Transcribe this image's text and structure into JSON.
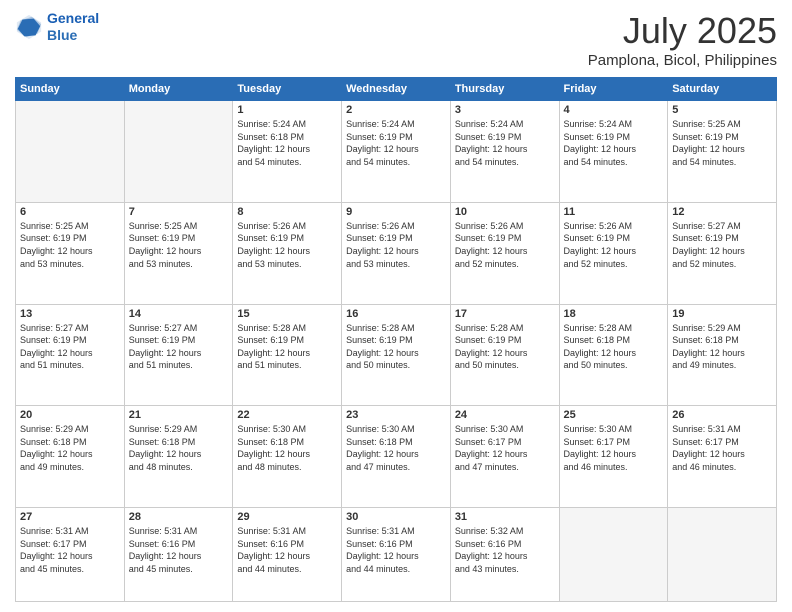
{
  "header": {
    "logo_line1": "General",
    "logo_line2": "Blue",
    "month": "July 2025",
    "location": "Pamplona, Bicol, Philippines"
  },
  "weekdays": [
    "Sunday",
    "Monday",
    "Tuesday",
    "Wednesday",
    "Thursday",
    "Friday",
    "Saturday"
  ],
  "weeks": [
    [
      {
        "day": "",
        "info": ""
      },
      {
        "day": "",
        "info": ""
      },
      {
        "day": "1",
        "info": "Sunrise: 5:24 AM\nSunset: 6:18 PM\nDaylight: 12 hours\nand 54 minutes."
      },
      {
        "day": "2",
        "info": "Sunrise: 5:24 AM\nSunset: 6:19 PM\nDaylight: 12 hours\nand 54 minutes."
      },
      {
        "day": "3",
        "info": "Sunrise: 5:24 AM\nSunset: 6:19 PM\nDaylight: 12 hours\nand 54 minutes."
      },
      {
        "day": "4",
        "info": "Sunrise: 5:24 AM\nSunset: 6:19 PM\nDaylight: 12 hours\nand 54 minutes."
      },
      {
        "day": "5",
        "info": "Sunrise: 5:25 AM\nSunset: 6:19 PM\nDaylight: 12 hours\nand 54 minutes."
      }
    ],
    [
      {
        "day": "6",
        "info": "Sunrise: 5:25 AM\nSunset: 6:19 PM\nDaylight: 12 hours\nand 53 minutes."
      },
      {
        "day": "7",
        "info": "Sunrise: 5:25 AM\nSunset: 6:19 PM\nDaylight: 12 hours\nand 53 minutes."
      },
      {
        "day": "8",
        "info": "Sunrise: 5:26 AM\nSunset: 6:19 PM\nDaylight: 12 hours\nand 53 minutes."
      },
      {
        "day": "9",
        "info": "Sunrise: 5:26 AM\nSunset: 6:19 PM\nDaylight: 12 hours\nand 53 minutes."
      },
      {
        "day": "10",
        "info": "Sunrise: 5:26 AM\nSunset: 6:19 PM\nDaylight: 12 hours\nand 52 minutes."
      },
      {
        "day": "11",
        "info": "Sunrise: 5:26 AM\nSunset: 6:19 PM\nDaylight: 12 hours\nand 52 minutes."
      },
      {
        "day": "12",
        "info": "Sunrise: 5:27 AM\nSunset: 6:19 PM\nDaylight: 12 hours\nand 52 minutes."
      }
    ],
    [
      {
        "day": "13",
        "info": "Sunrise: 5:27 AM\nSunset: 6:19 PM\nDaylight: 12 hours\nand 51 minutes."
      },
      {
        "day": "14",
        "info": "Sunrise: 5:27 AM\nSunset: 6:19 PM\nDaylight: 12 hours\nand 51 minutes."
      },
      {
        "day": "15",
        "info": "Sunrise: 5:28 AM\nSunset: 6:19 PM\nDaylight: 12 hours\nand 51 minutes."
      },
      {
        "day": "16",
        "info": "Sunrise: 5:28 AM\nSunset: 6:19 PM\nDaylight: 12 hours\nand 50 minutes."
      },
      {
        "day": "17",
        "info": "Sunrise: 5:28 AM\nSunset: 6:19 PM\nDaylight: 12 hours\nand 50 minutes."
      },
      {
        "day": "18",
        "info": "Sunrise: 5:28 AM\nSunset: 6:18 PM\nDaylight: 12 hours\nand 50 minutes."
      },
      {
        "day": "19",
        "info": "Sunrise: 5:29 AM\nSunset: 6:18 PM\nDaylight: 12 hours\nand 49 minutes."
      }
    ],
    [
      {
        "day": "20",
        "info": "Sunrise: 5:29 AM\nSunset: 6:18 PM\nDaylight: 12 hours\nand 49 minutes."
      },
      {
        "day": "21",
        "info": "Sunrise: 5:29 AM\nSunset: 6:18 PM\nDaylight: 12 hours\nand 48 minutes."
      },
      {
        "day": "22",
        "info": "Sunrise: 5:30 AM\nSunset: 6:18 PM\nDaylight: 12 hours\nand 48 minutes."
      },
      {
        "day": "23",
        "info": "Sunrise: 5:30 AM\nSunset: 6:18 PM\nDaylight: 12 hours\nand 47 minutes."
      },
      {
        "day": "24",
        "info": "Sunrise: 5:30 AM\nSunset: 6:17 PM\nDaylight: 12 hours\nand 47 minutes."
      },
      {
        "day": "25",
        "info": "Sunrise: 5:30 AM\nSunset: 6:17 PM\nDaylight: 12 hours\nand 46 minutes."
      },
      {
        "day": "26",
        "info": "Sunrise: 5:31 AM\nSunset: 6:17 PM\nDaylight: 12 hours\nand 46 minutes."
      }
    ],
    [
      {
        "day": "27",
        "info": "Sunrise: 5:31 AM\nSunset: 6:17 PM\nDaylight: 12 hours\nand 45 minutes."
      },
      {
        "day": "28",
        "info": "Sunrise: 5:31 AM\nSunset: 6:16 PM\nDaylight: 12 hours\nand 45 minutes."
      },
      {
        "day": "29",
        "info": "Sunrise: 5:31 AM\nSunset: 6:16 PM\nDaylight: 12 hours\nand 44 minutes."
      },
      {
        "day": "30",
        "info": "Sunrise: 5:31 AM\nSunset: 6:16 PM\nDaylight: 12 hours\nand 44 minutes."
      },
      {
        "day": "31",
        "info": "Sunrise: 5:32 AM\nSunset: 6:16 PM\nDaylight: 12 hours\nand 43 minutes."
      },
      {
        "day": "",
        "info": ""
      },
      {
        "day": "",
        "info": ""
      }
    ]
  ]
}
